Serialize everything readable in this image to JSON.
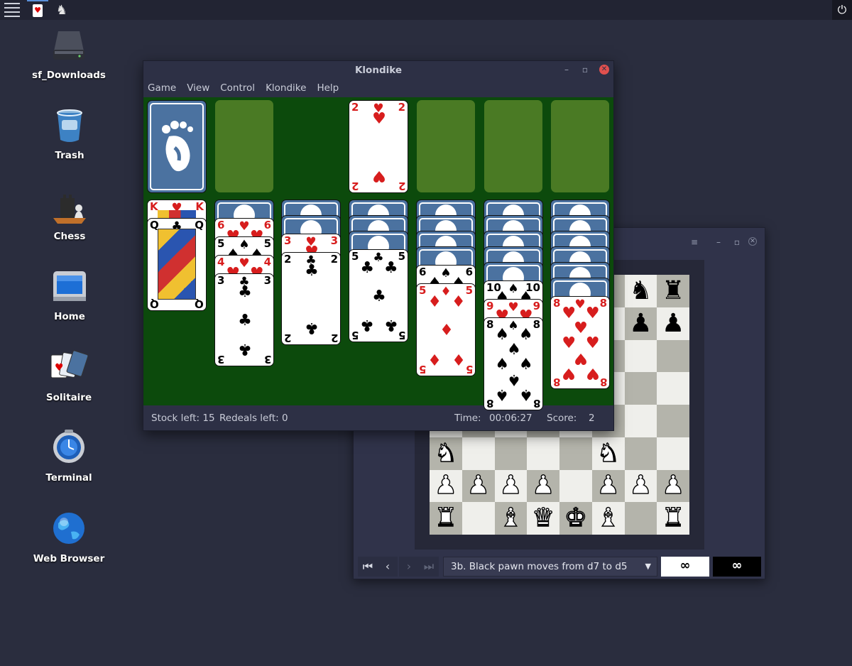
{
  "top_panel": {
    "menu_icon": "hamburger-icon",
    "tasks": [
      {
        "name": "Klondike",
        "icon": "solitaire-icon",
        "glyph": "♥"
      },
      {
        "name": "Chess",
        "icon": "chess-icon",
        "glyph": "♞"
      }
    ],
    "power_glyph": "⏻"
  },
  "desktop": {
    "icons": [
      {
        "label": "sf_Downloads",
        "icon": "drive-icon"
      },
      {
        "label": "Trash",
        "icon": "trash-icon"
      },
      {
        "label": "Chess",
        "icon": "chess-icon"
      },
      {
        "label": "Home",
        "icon": "home-icon"
      },
      {
        "label": "Solitaire",
        "icon": "solitaire-icon"
      },
      {
        "label": "Terminal",
        "icon": "terminal-icon"
      },
      {
        "label": "Web Browser",
        "icon": "globe-icon"
      }
    ]
  },
  "klondike": {
    "title": "Klondike",
    "menus": [
      "Game",
      "View",
      "Control",
      "Klondike",
      "Help"
    ],
    "status": {
      "stock_label": "Stock left: 15",
      "redeals_label": "Redeals left: 0",
      "time_label": "Time:",
      "time_value": "00:06:27",
      "score_label": "Score:",
      "score_value": "2"
    },
    "foundation_card": {
      "rank": "2",
      "suit": "♥"
    },
    "tableau": [
      {
        "hidden": 0,
        "face_up": [
          "K♥",
          "Q♣"
        ]
      },
      {
        "hidden": 1,
        "face_up": [
          "6♥",
          "5♠",
          "4♥",
          "3♣"
        ]
      },
      {
        "hidden": 2,
        "face_up": [
          "3♥",
          "2♣"
        ]
      },
      {
        "hidden": 3,
        "face_up": [
          "5♣"
        ]
      },
      {
        "hidden": 4,
        "face_up": [
          "6♠",
          "5♦"
        ]
      },
      {
        "hidden": 5,
        "face_up": [
          "10♠",
          "9♥",
          "8♠"
        ]
      },
      {
        "hidden": 6,
        "face_up": [
          "8♥"
        ]
      }
    ]
  },
  "chess": {
    "menu_glyph": "≡",
    "move_text": "3b. Black pawn moves from d7 to d5",
    "clock_white": "∞",
    "clock_black": "∞",
    "nav": {
      "first": "⏮",
      "prev": "‹",
      "next": "›",
      "last": "⏭"
    },
    "visible_rows": [
      [
        "",
        "",
        "",
        "",
        "",
        "",
        "♞",
        "♜"
      ],
      [
        "",
        "",
        "",
        "",
        "",
        "",
        "♟",
        "♟"
      ],
      [
        "",
        "",
        "",
        "",
        "",
        "",
        "",
        ""
      ],
      [
        "",
        "",
        "",
        "",
        "",
        "",
        "",
        ""
      ],
      [
        "",
        "",
        "",
        "",
        "",
        "",
        "",
        ""
      ],
      [
        "♘",
        "",
        "",
        "",
        "",
        "♘",
        "",
        ""
      ],
      [
        "♙",
        "♙",
        "♙",
        "♙",
        "",
        "♙",
        "♙",
        "♙"
      ],
      [
        "♖",
        "",
        "♗",
        "♕",
        "♔",
        "♗",
        "",
        "♖"
      ]
    ]
  }
}
